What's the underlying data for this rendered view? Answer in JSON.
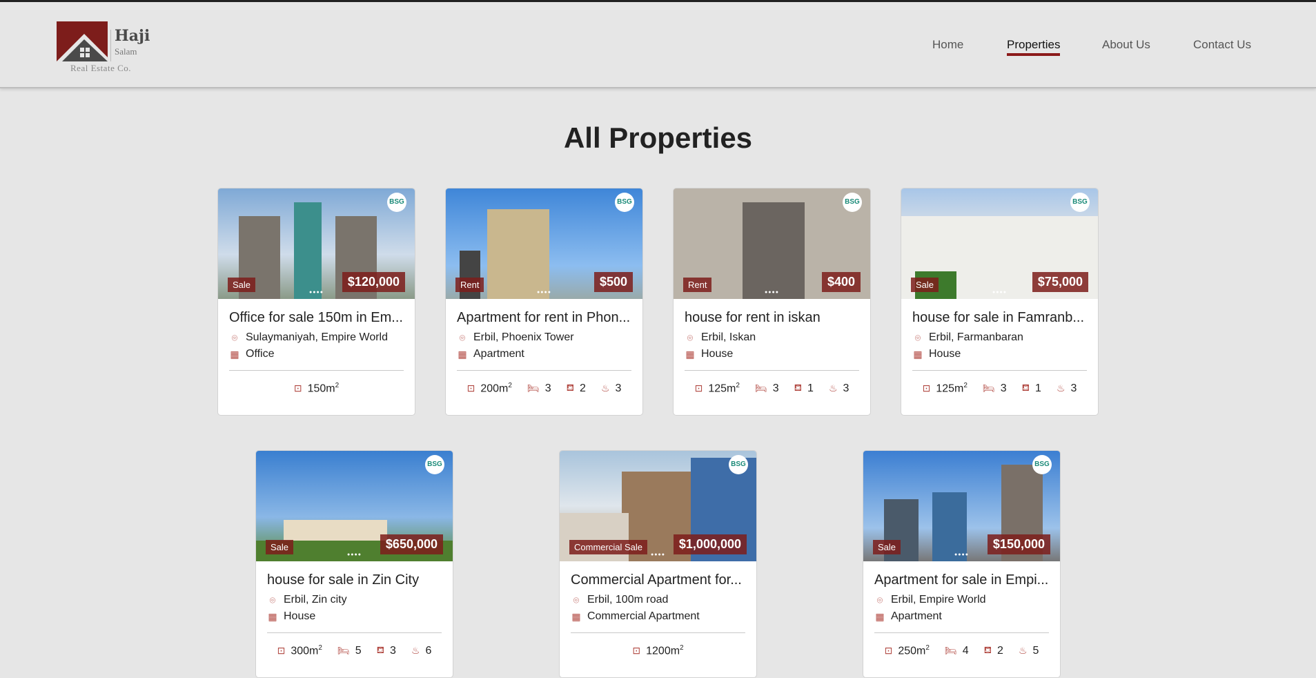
{
  "brand": {
    "name": "Haji",
    "sub": "Salam",
    "tagline": "Real Estate Co."
  },
  "nav": [
    {
      "label": "Home",
      "active": false
    },
    {
      "label": "Properties",
      "active": true
    },
    {
      "label": "About Us",
      "active": false
    },
    {
      "label": "Contact Us",
      "active": false
    }
  ],
  "page_title": "All Properties",
  "colors": {
    "accent": "#8b1a1a",
    "icon": "#b0453e"
  },
  "properties": [
    {
      "title": "Office for sale 150m in Em...",
      "location": "Sulaymaniyah, Empire World",
      "type": "Office",
      "badge": "Sale",
      "price": "$120,000",
      "area": "150m",
      "beds": null,
      "living": null,
      "baths": null
    },
    {
      "title": "Apartment for rent in Phon...",
      "location": "Erbil, Phoenix Tower",
      "type": "Apartment",
      "badge": "Rent",
      "price": "$500",
      "area": "200m",
      "beds": "3",
      "living": "2",
      "baths": "3"
    },
    {
      "title": "house for rent in iskan",
      "location": "Erbil, Iskan",
      "type": "House",
      "badge": "Rent",
      "price": "$400",
      "area": "125m",
      "beds": "3",
      "living": "1",
      "baths": "3"
    },
    {
      "title": "house for sale in Famranb...",
      "location": "Erbil, Farmanbaran",
      "type": "House",
      "badge": "Sale",
      "price": "$75,000",
      "area": "125m",
      "beds": "3",
      "living": "1",
      "baths": "3"
    },
    {
      "title": "house for sale in Zin City",
      "location": "Erbil, Zin city",
      "type": "House",
      "badge": "Sale",
      "price": "$650,000",
      "area": "300m",
      "beds": "5",
      "living": "3",
      "baths": "6"
    },
    {
      "title": "Commercial Apartment for...",
      "location": "Erbil, 100m road",
      "type": "Commercial Apartment",
      "badge": "Commercial Sale",
      "price": "$1,000,000",
      "area": "1200m",
      "beds": null,
      "living": null,
      "baths": null
    },
    {
      "title": "Apartment for sale in Empi...",
      "location": "Erbil, Empire World",
      "type": "Apartment",
      "badge": "Sale",
      "price": "$150,000",
      "area": "250m",
      "beds": "4",
      "living": "2",
      "baths": "5"
    }
  ],
  "watermark": "BSG"
}
